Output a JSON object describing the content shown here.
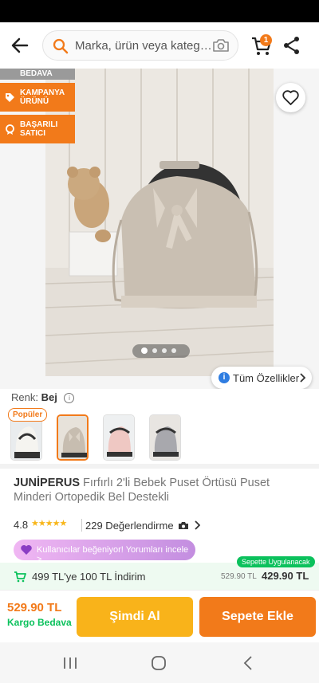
{
  "header": {
    "search_placeholder": "Marka, ürün veya kateg…",
    "cart_count": "1"
  },
  "gallery": {
    "tags": [
      "BEDAVA",
      "KAMPANYA ÜRÜNÜ",
      "BAŞARILI SATICI"
    ],
    "all_features": "Tüm Özellikler",
    "total_images": 4,
    "active_image_index": 0
  },
  "color": {
    "label": "Renk:",
    "value": "Bej"
  },
  "variants": {
    "popular_label": "Popüler",
    "thumbnails": [
      "white-cover",
      "beige-cover",
      "pink-cover",
      "gray-cover"
    ],
    "selected_index": 1
  },
  "product": {
    "brand": "JUNİPERUS",
    "title": "Fırfırlı 2'li Bebek Puset Örtüsü Puset Minderi Ortopedik Bel Destekli",
    "rating": "4.8",
    "stars": 5,
    "review_count": "229 Değerlendirme"
  },
  "promo": {
    "text": "Kullanıcılar beğeniyor! Yorumları incele >"
  },
  "discount": {
    "applied_badge": "Sepette Uygulanacak",
    "text": "499 TL'ye 100 TL İndirim",
    "old_price": "529.90 TL",
    "new_price": "429.90 TL"
  },
  "buy_bar": {
    "price": "529.90 TL",
    "shipping": "Kargo Bedava",
    "buy_now": "Şimdi Al",
    "add_to_cart": "Sepete Ekle"
  },
  "colors": {
    "brand_orange": "#f27a1a",
    "buy_yellow": "#f9b31a",
    "green": "#0bc15c"
  }
}
